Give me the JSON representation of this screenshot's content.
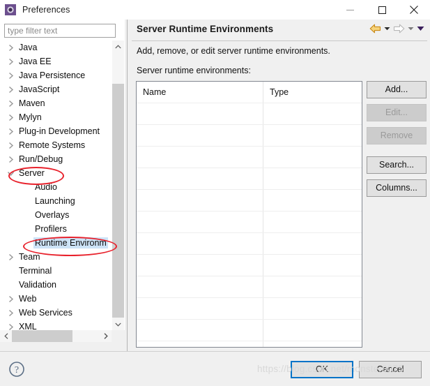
{
  "window": {
    "title": "Preferences",
    "icon": "preferences-gear-icon",
    "controls": {
      "minimize": "minimize-icon",
      "maximize": "maximize-icon",
      "close": "close-icon"
    }
  },
  "sidebar": {
    "filter": {
      "value": "",
      "placeholder": "type filter text"
    },
    "items": [
      {
        "label": "Java",
        "expandable": true,
        "level": 0,
        "selected": false
      },
      {
        "label": "Java EE",
        "expandable": true,
        "level": 0,
        "selected": false
      },
      {
        "label": "Java Persistence",
        "expandable": true,
        "level": 0,
        "selected": false
      },
      {
        "label": "JavaScript",
        "expandable": true,
        "level": 0,
        "selected": false
      },
      {
        "label": "Maven",
        "expandable": true,
        "level": 0,
        "selected": false
      },
      {
        "label": "Mylyn",
        "expandable": true,
        "level": 0,
        "selected": false
      },
      {
        "label": "Plug-in Development",
        "expandable": true,
        "level": 0,
        "selected": false
      },
      {
        "label": "Remote Systems",
        "expandable": true,
        "level": 0,
        "selected": false
      },
      {
        "label": "Run/Debug",
        "expandable": true,
        "level": 0,
        "selected": false
      },
      {
        "label": "Server",
        "expandable": true,
        "expanded": true,
        "level": 0,
        "selected": false
      },
      {
        "label": "Audio",
        "expandable": false,
        "level": 1,
        "selected": false
      },
      {
        "label": "Launching",
        "expandable": false,
        "level": 1,
        "selected": false
      },
      {
        "label": "Overlays",
        "expandable": false,
        "level": 1,
        "selected": false
      },
      {
        "label": "Profilers",
        "expandable": false,
        "level": 1,
        "selected": false
      },
      {
        "label": "Runtime Environm",
        "expandable": false,
        "level": 1,
        "selected": true
      },
      {
        "label": "Team",
        "expandable": true,
        "level": 0,
        "selected": false
      },
      {
        "label": "Terminal",
        "expandable": false,
        "level": 0,
        "selected": false
      },
      {
        "label": "Validation",
        "expandable": false,
        "level": 0,
        "selected": false
      },
      {
        "label": "Web",
        "expandable": true,
        "level": 0,
        "selected": false
      },
      {
        "label": "Web Services",
        "expandable": true,
        "level": 0,
        "selected": false
      },
      {
        "label": "XML",
        "expandable": true,
        "level": 0,
        "selected": false
      }
    ],
    "scrollbars": {
      "vertical": "tree-vertical-scrollbar",
      "horizontal": "tree-horizontal-scrollbar",
      "up_arrow": "chevron-up-icon",
      "down_arrow": "chevron-down-icon",
      "left_arrow": "chevron-left-icon",
      "right_arrow": "chevron-right-icon"
    }
  },
  "page": {
    "title": "Server Runtime Environments",
    "description": "Add, remove, or edit server runtime environments.",
    "list_label": "Server runtime environments:",
    "nav": {
      "back": "back-arrow-icon",
      "back_menu": "chevron-down-icon",
      "forward": "forward-arrow-icon",
      "forward_menu": "chevron-down-icon",
      "view_menu": "chevron-down-icon"
    },
    "table": {
      "columns": [
        "Name",
        "Type"
      ],
      "rows": [],
      "empty_row_count": 12
    },
    "buttons": [
      {
        "label": "Add...",
        "enabled": true,
        "name": "add-button"
      },
      {
        "label": "Edit...",
        "enabled": false,
        "name": "edit-button"
      },
      {
        "label": "Remove",
        "enabled": false,
        "name": "remove-button"
      },
      {
        "label": "Search...",
        "enabled": true,
        "name": "search-button",
        "gap_above": true
      },
      {
        "label": "Columns...",
        "enabled": true,
        "name": "columns-button"
      }
    ]
  },
  "footer": {
    "help": "help-icon",
    "ok_label": "OK",
    "cancel_label": "Cancel"
  },
  "annotations": {
    "ellipse_color": "#e8212b",
    "targets": [
      "Server",
      "Runtime Environm"
    ]
  },
  "watermark": {
    "text": "https://blog.csdn.net/monster0075"
  },
  "colors": {
    "selection": "#cde3f7",
    "dialog_bg": "#f0f0f0",
    "focus_border": "#0073c8",
    "annotation": "#e8212b"
  }
}
